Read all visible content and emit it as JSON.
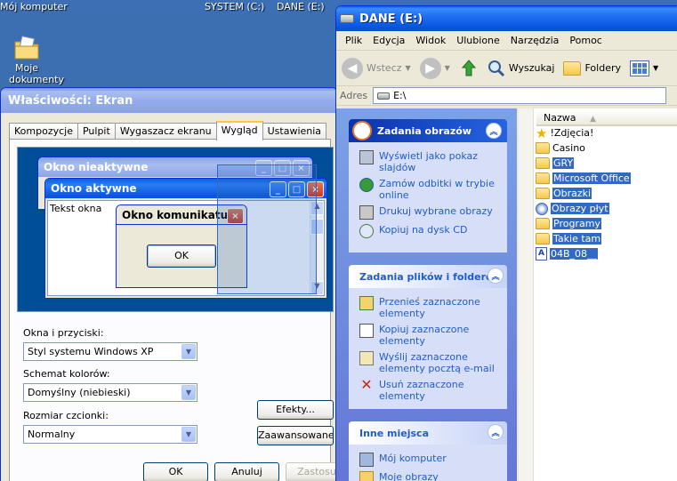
{
  "desktop": {
    "top_labels": [
      "Mój komputer",
      "SYSTEM (C:)",
      "DANE (E:)"
    ],
    "icon_label_line1": "Moje",
    "icon_label_line2": "dokumenty"
  },
  "props": {
    "title": "Właściwości: Ekran",
    "tabs": [
      "Kompozycje",
      "Pulpit",
      "Wygaszacz ekranu",
      "Wygląd",
      "Ustawienia"
    ],
    "active_tab": "Wygląd",
    "preview": {
      "inactive_title": "Okno nieaktywne",
      "active_title": "Okno aktywne",
      "window_text": "Tekst okna",
      "message_title": "Okno komunikatu",
      "ok": "OK"
    },
    "windows_buttons_label": "Okna i przyciski:",
    "windows_buttons_value": "Styl systemu Windows XP",
    "color_scheme_label": "Schemat kolorów:",
    "color_scheme_value": "Domyślny (niebieski)",
    "font_size_label": "Rozmiar czcionki:",
    "font_size_value": "Normalny",
    "effects_btn": "Efekty...",
    "advanced_btn": "Zaawansowane",
    "ok_btn": "OK",
    "cancel_btn": "Anuluj",
    "apply_btn": "Zastosuj"
  },
  "explorer": {
    "title": "DANE (E:)",
    "menu": [
      "Plik",
      "Edycja",
      "Widok",
      "Ulubione",
      "Narzędzia",
      "Pomoc"
    ],
    "back": "Wstecz",
    "search": "Wyszukaj",
    "folders": "Foldery",
    "address_label": "Adres",
    "address_value": "E:\\",
    "image_tasks": {
      "title": "Zadania obrazów",
      "items": [
        [
          "Wyświetl jako pokaz",
          "slajdów"
        ],
        [
          "Zamów odbitki w trybie",
          "online"
        ],
        [
          "Drukuj wybrane obrazy"
        ],
        [
          "Kopiuj na dysk CD"
        ]
      ]
    },
    "file_tasks": {
      "title": "Zadania plików i folderów",
      "items": [
        [
          "Przenieś zaznaczone",
          "elementy"
        ],
        [
          "Kopiuj zaznaczone",
          "elementy"
        ],
        [
          "Wyślij zaznaczone",
          "elementy pocztą e-mail"
        ],
        [
          "Usuń zaznaczone",
          "elementy"
        ]
      ]
    },
    "other_places": {
      "title": "Inne miejsca",
      "items": [
        [
          "Mój komputer"
        ],
        [
          "Moje obrazy"
        ]
      ]
    },
    "column_name": "Nazwa",
    "files": [
      {
        "name": "!Zdjęcia!",
        "selected": false,
        "kind": "star"
      },
      {
        "name": "Casino",
        "selected": false,
        "kind": "folder"
      },
      {
        "name": "GRY",
        "selected": true,
        "kind": "folder"
      },
      {
        "name": "Microsoft Office",
        "selected": true,
        "kind": "folder"
      },
      {
        "name": "Obrazki",
        "selected": true,
        "kind": "folder"
      },
      {
        "name": "Obrazy płyt",
        "selected": true,
        "kind": "disc"
      },
      {
        "name": "Programy",
        "selected": true,
        "kind": "folder"
      },
      {
        "name": "Takie tam",
        "selected": true,
        "kind": "folder"
      },
      {
        "name": "04B_08__",
        "selected": true,
        "kind": "font"
      }
    ]
  }
}
